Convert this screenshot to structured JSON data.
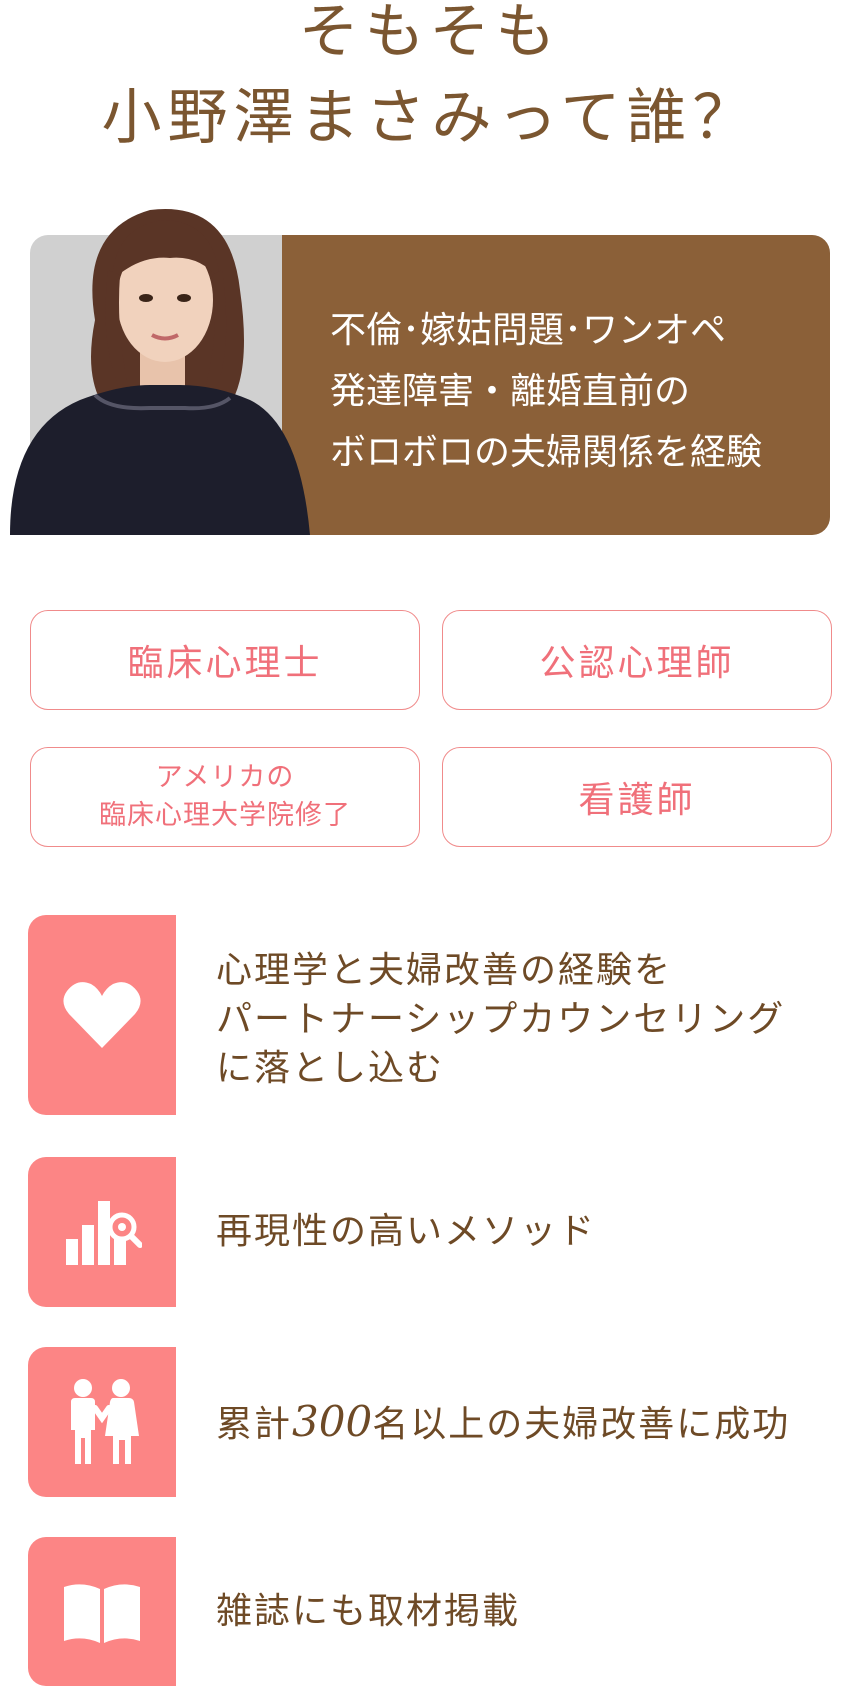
{
  "title": {
    "line1": "そもそも",
    "line2": "小野澤まさみって誰？"
  },
  "profile": {
    "lines": [
      "不倫･嫁姑問題･ワンオペ",
      "発達障害・離婚直前の",
      "ボロボロの夫婦関係を経験"
    ]
  },
  "qualifications": {
    "q1": "臨床心理士",
    "q2": "公認心理師",
    "q3_line1": "アメリカの",
    "q3_line2": "臨床心理大学院修了",
    "q4": "看護師"
  },
  "features": [
    {
      "icon": "heart-icon",
      "lines": [
        "心理学と夫婦改善の経験を",
        "パートナーシップカウンセリング",
        "に落とし込む"
      ]
    },
    {
      "icon": "chart-search-icon",
      "lines": [
        "再現性の高いメソッド"
      ]
    },
    {
      "icon": "couple-icon",
      "prefix": "累計",
      "number": "300",
      "suffix": "名以上の夫婦改善に成功"
    },
    {
      "icon": "open-book-icon",
      "lines": [
        "雑誌にも取材掲載"
      ]
    }
  ],
  "colors": {
    "brown": "#8b6038",
    "title": "#7b5630",
    "pink": "#fc8585",
    "pink_text": "#f0707a"
  }
}
